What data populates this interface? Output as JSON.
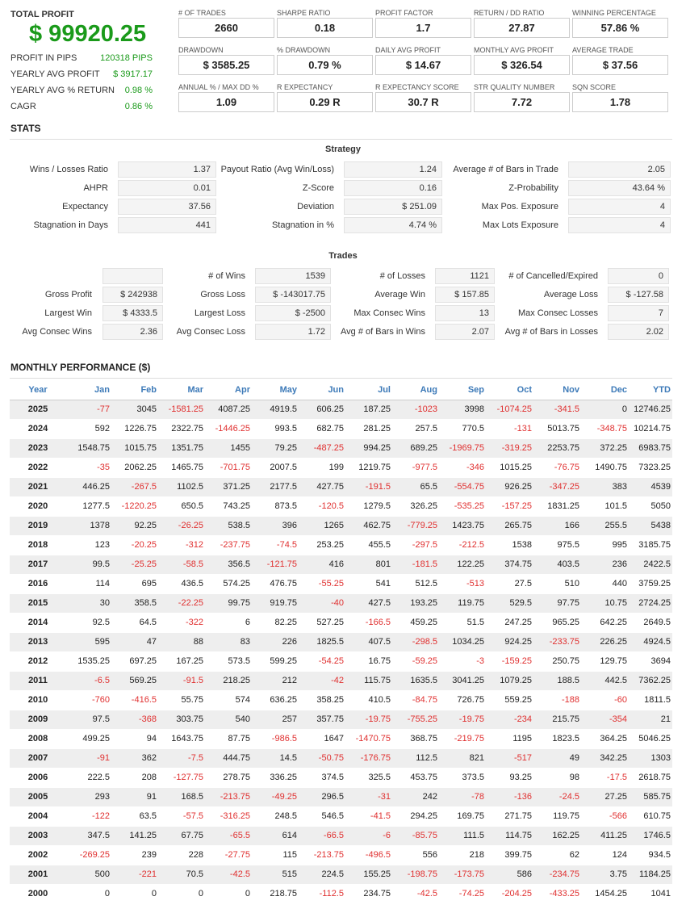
{
  "total_profit": {
    "label": "TOTAL PROFIT",
    "value": "$ 99920.25"
  },
  "summary": [
    {
      "label": "PROFIT IN PIPS",
      "value": "120318 PIPS"
    },
    {
      "label": "YEARLY AVG PROFIT",
      "value": "$ 3917.17"
    },
    {
      "label": "YEARLY AVG % RETURN",
      "value": "0.98 %"
    },
    {
      "label": "CAGR",
      "value": "0.86 %"
    }
  ],
  "cards": [
    {
      "label": "# OF TRADES",
      "value": "2660"
    },
    {
      "label": "SHARPE RATIO",
      "value": "0.18"
    },
    {
      "label": "PROFIT FACTOR",
      "value": "1.7"
    },
    {
      "label": "RETURN / DD RATIO",
      "value": "27.87"
    },
    {
      "label": "WINNING PERCENTAGE",
      "value": "57.86 %"
    },
    {
      "label": "DRAWDOWN",
      "value": "$ 3585.25"
    },
    {
      "label": "% DRAWDOWN",
      "value": "0.79 %"
    },
    {
      "label": "DAILY AVG PROFIT",
      "value": "$ 14.67"
    },
    {
      "label": "MONTHLY AVG PROFIT",
      "value": "$ 326.54"
    },
    {
      "label": "AVERAGE TRADE",
      "value": "$ 37.56"
    },
    {
      "label": "ANNUAL % / MAX DD %",
      "value": "1.09"
    },
    {
      "label": "R EXPECTANCY",
      "value": "0.29 R"
    },
    {
      "label": "R EXPECTANCY SCORE",
      "value": "30.7 R"
    },
    {
      "label": "STR QUALITY NUMBER",
      "value": "7.72"
    },
    {
      "label": "SQN SCORE",
      "value": "1.78"
    }
  ],
  "stats_title": "STATS",
  "strategy": {
    "title": "Strategy",
    "rows": [
      [
        {
          "label": "Wins / Losses Ratio",
          "value": "1.37"
        },
        {
          "label": "Payout Ratio (Avg Win/Loss)",
          "value": "1.24"
        },
        {
          "label": "Average # of Bars in Trade",
          "value": "2.05"
        }
      ],
      [
        {
          "label": "AHPR",
          "value": "0.01"
        },
        {
          "label": "Z-Score",
          "value": "0.16"
        },
        {
          "label": "Z-Probability",
          "value": "43.64 %"
        }
      ],
      [
        {
          "label": "Expectancy",
          "value": "37.56"
        },
        {
          "label": "Deviation",
          "value": "$ 251.09"
        },
        {
          "label": "Max Pos. Exposure",
          "value": "4"
        }
      ],
      [
        {
          "label": "Stagnation in Days",
          "value": "441"
        },
        {
          "label": "Stagnation in %",
          "value": "4.74 %"
        },
        {
          "label": "Max Lots Exposure",
          "value": "4"
        }
      ]
    ]
  },
  "trades": {
    "title": "Trades",
    "rows": [
      [
        {
          "label": "",
          "value": ""
        },
        {
          "label": "# of Wins",
          "value": "1539"
        },
        {
          "label": "# of Losses",
          "value": "1121"
        },
        {
          "label": "# of Cancelled/Expired",
          "value": "0"
        }
      ],
      [
        {
          "label": "Gross Profit",
          "value": "$ 242938"
        },
        {
          "label": "Gross Loss",
          "value": "$ -143017.75"
        },
        {
          "label": "Average Win",
          "value": "$ 157.85"
        },
        {
          "label": "Average Loss",
          "value": "$ -127.58"
        }
      ],
      [
        {
          "label": "Largest Win",
          "value": "$ 4333.5"
        },
        {
          "label": "Largest Loss",
          "value": "$ -2500"
        },
        {
          "label": "Max Consec Wins",
          "value": "13"
        },
        {
          "label": "Max Consec Losses",
          "value": "7"
        }
      ],
      [
        {
          "label": "Avg Consec Wins",
          "value": "2.36"
        },
        {
          "label": "Avg Consec Loss",
          "value": "1.72"
        },
        {
          "label": "Avg # of Bars in Wins",
          "value": "2.07"
        },
        {
          "label": "Avg # of Bars in Losses",
          "value": "2.02"
        }
      ]
    ]
  },
  "monthly": {
    "title": "MONTHLY PERFORMANCE ($)",
    "headers": [
      "Year",
      "Jan",
      "Feb",
      "Mar",
      "Apr",
      "May",
      "Jun",
      "Jul",
      "Aug",
      "Sep",
      "Oct",
      "Nov",
      "Dec",
      "YTD"
    ],
    "rows": [
      [
        "2025",
        "-77",
        "3045",
        "-1581.25",
        "4087.25",
        "4919.5",
        "606.25",
        "187.25",
        "-1023",
        "3998",
        "-1074.25",
        "-341.5",
        "0",
        "12746.25"
      ],
      [
        "2024",
        "592",
        "1226.75",
        "2322.75",
        "-1446.25",
        "993.5",
        "682.75",
        "281.25",
        "257.5",
        "770.5",
        "-131",
        "5013.75",
        "-348.75",
        "10214.75"
      ],
      [
        "2023",
        "1548.75",
        "1015.75",
        "1351.75",
        "1455",
        "79.25",
        "-487.25",
        "994.25",
        "689.25",
        "-1969.75",
        "-319.25",
        "2253.75",
        "372.25",
        "6983.75"
      ],
      [
        "2022",
        "-35",
        "2062.25",
        "1465.75",
        "-701.75",
        "2007.5",
        "199",
        "1219.75",
        "-977.5",
        "-346",
        "1015.25",
        "-76.75",
        "1490.75",
        "7323.25"
      ],
      [
        "2021",
        "446.25",
        "-267.5",
        "1102.5",
        "371.25",
        "2177.5",
        "427.75",
        "-191.5",
        "65.5",
        "-554.75",
        "926.25",
        "-347.25",
        "383",
        "4539"
      ],
      [
        "2020",
        "1277.5",
        "-1220.25",
        "650.5",
        "743.25",
        "873.5",
        "-120.5",
        "1279.5",
        "326.25",
        "-535.25",
        "-157.25",
        "1831.25",
        "101.5",
        "5050"
      ],
      [
        "2019",
        "1378",
        "92.25",
        "-26.25",
        "538.5",
        "396",
        "1265",
        "462.75",
        "-779.25",
        "1423.75",
        "265.75",
        "166",
        "255.5",
        "5438"
      ],
      [
        "2018",
        "123",
        "-20.25",
        "-312",
        "-237.75",
        "-74.5",
        "253.25",
        "455.5",
        "-297.5",
        "-212.5",
        "1538",
        "975.5",
        "995",
        "3185.75"
      ],
      [
        "2017",
        "99.5",
        "-25.25",
        "-58.5",
        "356.5",
        "-121.75",
        "416",
        "801",
        "-181.5",
        "122.25",
        "374.75",
        "403.5",
        "236",
        "2422.5"
      ],
      [
        "2016",
        "114",
        "695",
        "436.5",
        "574.25",
        "476.75",
        "-55.25",
        "541",
        "512.5",
        "-513",
        "27.5",
        "510",
        "440",
        "3759.25"
      ],
      [
        "2015",
        "30",
        "358.5",
        "-22.25",
        "99.75",
        "919.75",
        "-40",
        "427.5",
        "193.25",
        "119.75",
        "529.5",
        "97.75",
        "10.75",
        "2724.25"
      ],
      [
        "2014",
        "92.5",
        "64.5",
        "-322",
        "6",
        "82.25",
        "527.25",
        "-166.5",
        "459.25",
        "51.5",
        "247.25",
        "965.25",
        "642.25",
        "2649.5"
      ],
      [
        "2013",
        "595",
        "47",
        "88",
        "83",
        "226",
        "1825.5",
        "407.5",
        "-298.5",
        "1034.25",
        "924.25",
        "-233.75",
        "226.25",
        "4924.5"
      ],
      [
        "2012",
        "1535.25",
        "697.25",
        "167.25",
        "573.5",
        "599.25",
        "-54.25",
        "16.75",
        "-59.25",
        "-3",
        "-159.25",
        "250.75",
        "129.75",
        "3694"
      ],
      [
        "2011",
        "-6.5",
        "569.25",
        "-91.5",
        "218.25",
        "212",
        "-42",
        "115.75",
        "1635.5",
        "3041.25",
        "1079.25",
        "188.5",
        "442.5",
        "7362.25"
      ],
      [
        "2010",
        "-760",
        "-416.5",
        "55.75",
        "574",
        "636.25",
        "358.25",
        "410.5",
        "-84.75",
        "726.75",
        "559.25",
        "-188",
        "-60",
        "1811.5"
      ],
      [
        "2009",
        "97.5",
        "-368",
        "303.75",
        "540",
        "257",
        "357.75",
        "-19.75",
        "-755.25",
        "-19.75",
        "-234",
        "215.75",
        "-354",
        "21"
      ],
      [
        "2008",
        "499.25",
        "94",
        "1643.75",
        "87.75",
        "-986.5",
        "1647",
        "-1470.75",
        "368.75",
        "-219.75",
        "1195",
        "1823.5",
        "364.25",
        "5046.25"
      ],
      [
        "2007",
        "-91",
        "362",
        "-7.5",
        "444.75",
        "14.5",
        "-50.75",
        "-176.75",
        "112.5",
        "821",
        "-517",
        "49",
        "342.25",
        "1303"
      ],
      [
        "2006",
        "222.5",
        "208",
        "-127.75",
        "278.75",
        "336.25",
        "374.5",
        "325.5",
        "453.75",
        "373.5",
        "93.25",
        "98",
        "-17.5",
        "2618.75"
      ],
      [
        "2005",
        "293",
        "91",
        "168.5",
        "-213.75",
        "-49.25",
        "296.5",
        "-31",
        "242",
        "-78",
        "-136",
        "-24.5",
        "27.25",
        "585.75"
      ],
      [
        "2004",
        "-122",
        "63.5",
        "-57.5",
        "-316.25",
        "248.5",
        "546.5",
        "-41.5",
        "294.25",
        "169.75",
        "271.75",
        "119.75",
        "-566",
        "610.75"
      ],
      [
        "2003",
        "347.5",
        "141.25",
        "67.75",
        "-65.5",
        "614",
        "-66.5",
        "-6",
        "-85.75",
        "111.5",
        "114.75",
        "162.25",
        "411.25",
        "1746.5"
      ],
      [
        "2002",
        "-269.25",
        "239",
        "228",
        "-27.75",
        "115",
        "-213.75",
        "-496.5",
        "556",
        "218",
        "399.75",
        "62",
        "124",
        "934.5"
      ],
      [
        "2001",
        "500",
        "-221",
        "70.5",
        "-42.5",
        "515",
        "224.5",
        "155.25",
        "-198.75",
        "-173.75",
        "586",
        "-234.75",
        "3.75",
        "1184.25"
      ],
      [
        "2000",
        "0",
        "0",
        "0",
        "0",
        "218.75",
        "-112.5",
        "234.75",
        "-42.5",
        "-74.25",
        "-204.25",
        "-433.25",
        "1454.25",
        "1041"
      ]
    ]
  },
  "colors": {
    "positive": "#1a9a1a",
    "negative": "#e03030",
    "header": "#3d7ab8"
  }
}
